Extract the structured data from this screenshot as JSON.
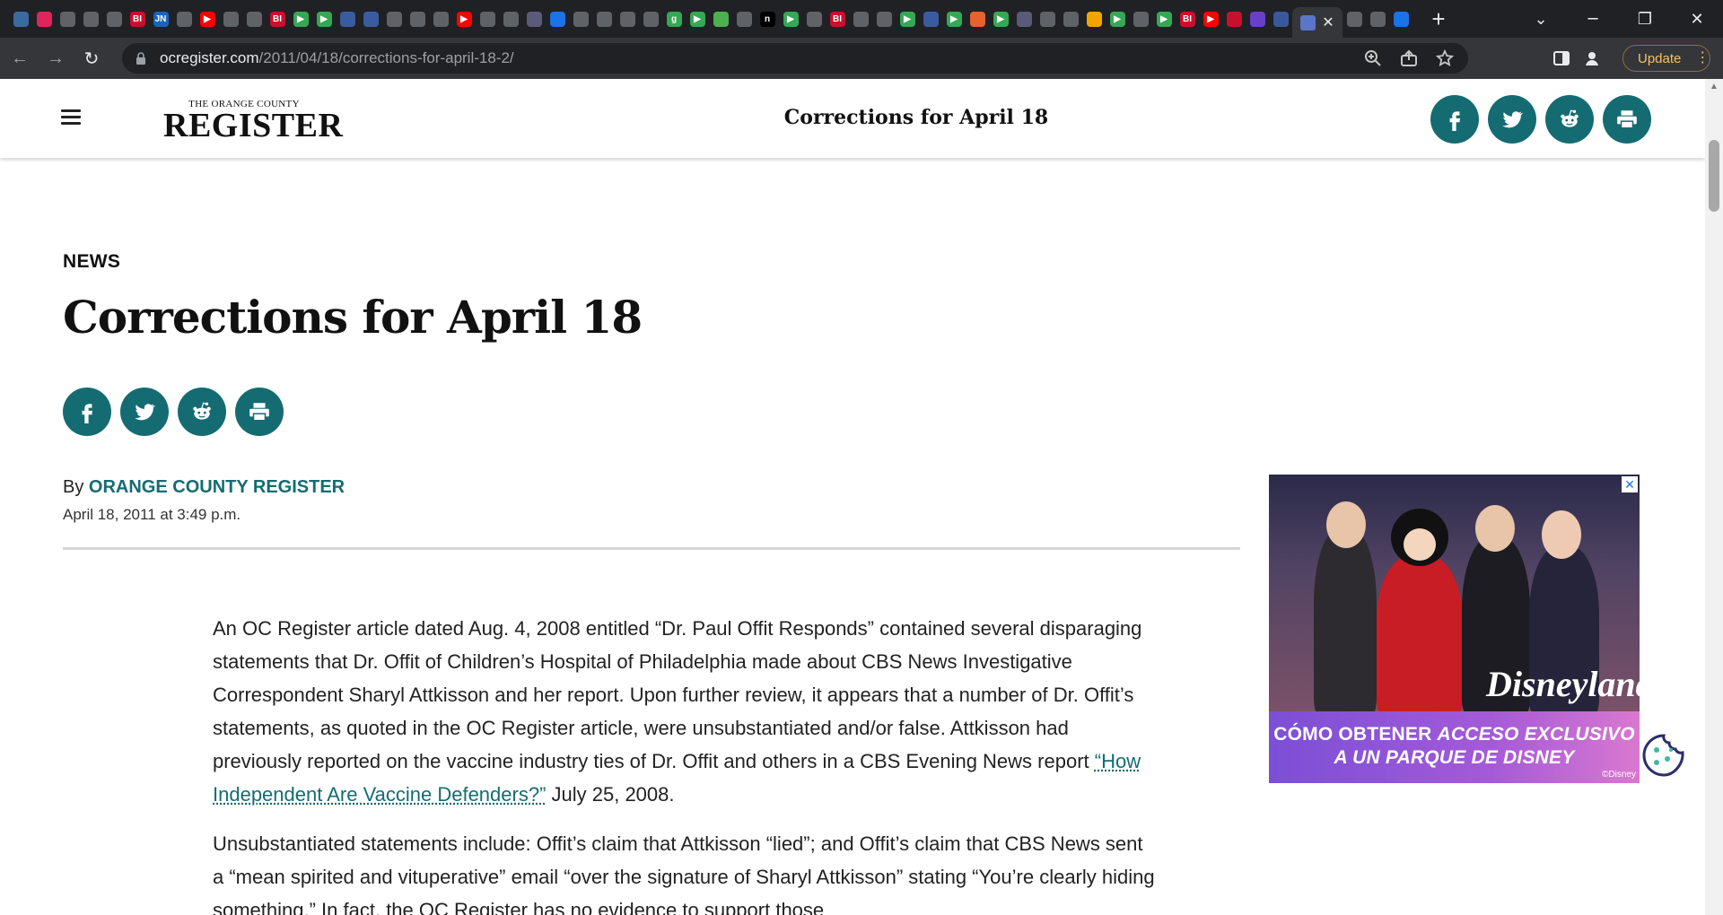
{
  "browser": {
    "url_host": "ocregister.com",
    "url_path": "/2011/04/18/corrections-for-april-18-2/",
    "update_label": "Update",
    "tab_favicons": [
      {
        "color": "#3b6aa0",
        "glyph": ""
      },
      {
        "color": "#e0245e",
        "glyph": ""
      },
      {
        "color": "#5f6368",
        "glyph": ""
      },
      {
        "color": "#5f6368",
        "glyph": ""
      },
      {
        "color": "#5f6368",
        "glyph": ""
      },
      {
        "color": "#c8102e",
        "glyph": "BI"
      },
      {
        "color": "#1565c0",
        "glyph": "JN"
      },
      {
        "color": "#5f6368",
        "glyph": ""
      },
      {
        "color": "#ff0000",
        "glyph": "▶"
      },
      {
        "color": "#5f6368",
        "glyph": ""
      },
      {
        "color": "#5f6368",
        "glyph": ""
      },
      {
        "color": "#c8102e",
        "glyph": "BI"
      },
      {
        "color": "#35a854",
        "glyph": "▶"
      },
      {
        "color": "#35a854",
        "glyph": "▶"
      },
      {
        "color": "#3a5ba0",
        "glyph": ""
      },
      {
        "color": "#3a5ba0",
        "glyph": ""
      },
      {
        "color": "#5f6368",
        "glyph": ""
      },
      {
        "color": "#5f6368",
        "glyph": ""
      },
      {
        "color": "#5f6368",
        "glyph": ""
      },
      {
        "color": "#ff0000",
        "glyph": "▶"
      },
      {
        "color": "#5f6368",
        "glyph": ""
      },
      {
        "color": "#5f6368",
        "glyph": ""
      },
      {
        "color": "#5a5a7a",
        "glyph": ""
      },
      {
        "color": "#1a73e8",
        "glyph": ""
      },
      {
        "color": "#5f6368",
        "glyph": ""
      },
      {
        "color": "#5f6368",
        "glyph": ""
      },
      {
        "color": "#5f6368",
        "glyph": ""
      },
      {
        "color": "#5f6368",
        "glyph": ""
      },
      {
        "color": "#34a853",
        "glyph": "g"
      },
      {
        "color": "#35a854",
        "glyph": "▶"
      },
      {
        "color": "#4caf50",
        "glyph": ""
      },
      {
        "color": "#5f6368",
        "glyph": ""
      },
      {
        "color": "#000000",
        "glyph": "n"
      },
      {
        "color": "#35a854",
        "glyph": "▶"
      },
      {
        "color": "#5f6368",
        "glyph": ""
      },
      {
        "color": "#c8102e",
        "glyph": "BI"
      },
      {
        "color": "#5f6368",
        "glyph": ""
      },
      {
        "color": "#5f6368",
        "glyph": ""
      },
      {
        "color": "#35a854",
        "glyph": "▶"
      },
      {
        "color": "#3a5ba0",
        "glyph": ""
      },
      {
        "color": "#35a854",
        "glyph": "▶"
      },
      {
        "color": "#e8622c",
        "glyph": ""
      },
      {
        "color": "#35a854",
        "glyph": "▶"
      },
      {
        "color": "#5a5a7a",
        "glyph": ""
      },
      {
        "color": "#5f6368",
        "glyph": ""
      },
      {
        "color": "#5f6368",
        "glyph": ""
      },
      {
        "color": "#f4a400",
        "glyph": ""
      },
      {
        "color": "#35a854",
        "glyph": "▶"
      },
      {
        "color": "#5f6368",
        "glyph": ""
      },
      {
        "color": "#35a854",
        "glyph": "▶"
      },
      {
        "color": "#c8102e",
        "glyph": "BI"
      },
      {
        "color": "#ff0000",
        "glyph": "▶"
      },
      {
        "color": "#c8102e",
        "glyph": ""
      },
      {
        "color": "#6a3fc8",
        "glyph": ""
      },
      {
        "color": "#3b5998",
        "glyph": ""
      }
    ]
  },
  "header": {
    "logo_small": "THE ORANGE COUNTY",
    "logo_big": "REGISTER",
    "title": "Corrections for April 18"
  },
  "article": {
    "section": "NEWS",
    "headline": "Corrections for April 18",
    "byline_prefix": "By",
    "author": "Orange County Register",
    "date": "April 18, 2011 at 3:49 p.m.",
    "p1_before_link": "An OC Register article dated Aug. 4, 2008 entitled “Dr. Paul Offit Responds” contained several disparaging statements that Dr. Offit of Children’s Hospital of Philadelphia made about CBS News Investigative Correspondent Sharyl Attkisson and her report. Upon further review, it appears that a number of Dr. Offit’s statements, as quoted in the OC Register article, were unsubstantiated and/or false. Attkisson had previously reported on the vaccine industry ties of Dr. Offit and others in a CBS Evening News report ",
    "p1_link": "“How Independent Are Vaccine Defenders?”",
    "p1_after_link": " July 25, 2008.",
    "p2": "Unsubstantiated statements include: Offit’s claim that Attkisson “lied”; and Offit’s claim that CBS News sent a “mean spirited and vituperative” email “over the signature of Sharyl Attkisson” stating “You’re clearly hiding something.” In fact, the OC Register has no evidence to support those"
  },
  "ad": {
    "brand": "Disneyland",
    "line1_a": "CÓMO OBTENER ",
    "line1_b": "ACCESO EXCLUSIVO",
    "line2": "A UN PARQUE DE DISNEY",
    "copyright": "©Disney",
    "close_glyph": "✕"
  },
  "colors": {
    "brand_teal": "#146c72"
  }
}
